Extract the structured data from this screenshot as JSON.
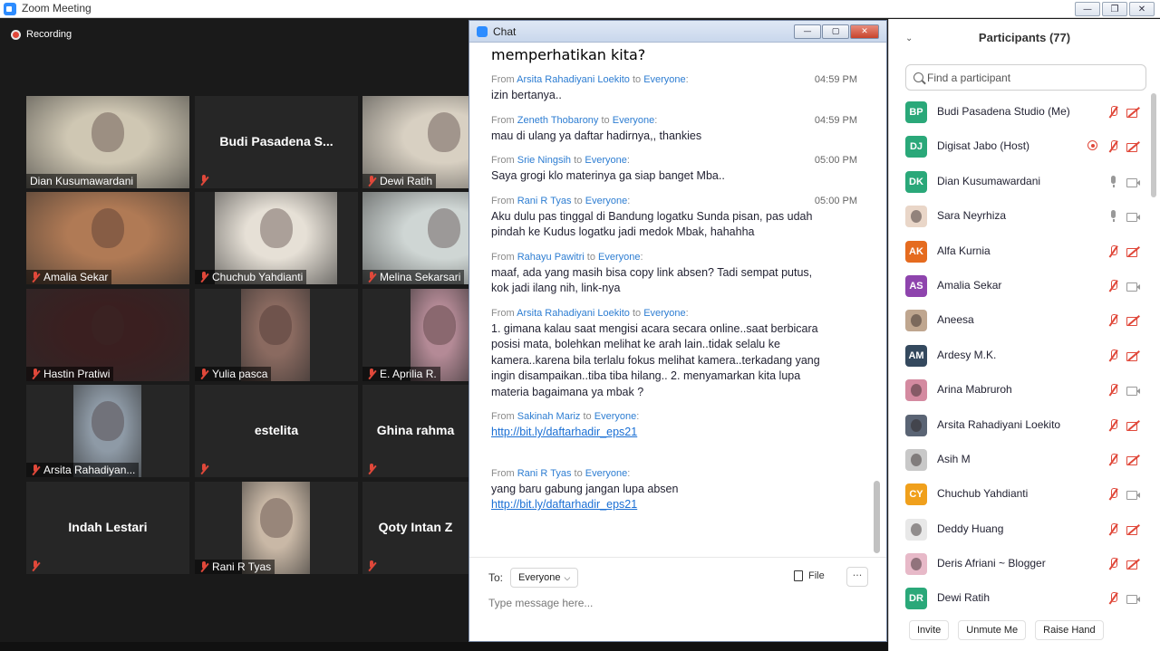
{
  "window": {
    "title": "Zoom Meeting"
  },
  "recording": {
    "label": "Recording"
  },
  "grid": [
    {
      "name": "Dian Kusumawardani",
      "muted": false,
      "video": true,
      "color": "#cfc7b3"
    },
    {
      "name": "Budi Pasadena S...",
      "muted": true,
      "video": false,
      "big": true
    },
    {
      "name": "Dewi Ratih",
      "muted": true,
      "video": true,
      "color": "#d8d0c2"
    },
    {
      "name": "Amalia Sekar",
      "muted": true,
      "video": true,
      "color": "#b07a55"
    },
    {
      "name": "Chuchub Yahdianti",
      "muted": true,
      "video": true,
      "color": "#e6e0d6"
    },
    {
      "name": "Melina Sekarsari",
      "muted": true,
      "video": true,
      "color": "#cfd6d4"
    },
    {
      "name": "Hastin Pratiwi",
      "muted": true,
      "video": true,
      "color": "#3a1f20"
    },
    {
      "name": "Yulia pasca",
      "muted": true,
      "video": true,
      "color": "#8a6a60"
    },
    {
      "name": "E. Aprilia R.",
      "muted": true,
      "video": true,
      "color": "#b48a96"
    },
    {
      "name": "Arsita Rahadiyan...",
      "muted": true,
      "video": true,
      "color": "#8e9aa6"
    },
    {
      "name": "estelita",
      "muted": true,
      "video": false,
      "big": true
    },
    {
      "name": "Ghina rahma",
      "muted": true,
      "video": false,
      "big": true
    },
    {
      "name": "Indah Lestari",
      "muted": true,
      "video": false,
      "big": true
    },
    {
      "name": "Rani R Tyas",
      "muted": true,
      "video": true,
      "color": "#c9b8a6"
    },
    {
      "name": "Qoty Intan Z",
      "muted": true,
      "video": false,
      "big": true
    }
  ],
  "chat": {
    "title": "Chat",
    "clipped_top": "memperhatikan kita?",
    "messages": [
      {
        "from": "Arsita Rahadiyani Loekito",
        "to": "Everyone",
        "time": "04:59 PM",
        "text": "izin bertanya.."
      },
      {
        "from": "Zeneth Thobarony",
        "to": "Everyone",
        "time": "04:59 PM",
        "text": "mau di ulang ya daftar hadirnya,, thankies"
      },
      {
        "from": "Srie Ningsih",
        "to": "Everyone",
        "time": "05:00 PM",
        "text": "Saya  grogi klo materinya ga siap banget Mba.."
      },
      {
        "from": "Rani R Tyas",
        "to": "Everyone",
        "time": "05:00 PM",
        "text": "Aku dulu pas tinggal di Bandung logatku Sunda pisan, pas udah\npindah ke Kudus logatku jadi medok Mbak, hahahha"
      },
      {
        "from": "Rahayu Pawitri",
        "to": "Everyone",
        "time": "",
        "text": "maaf, ada yang masih bisa copy link absen? Tadi sempat putus,\nkok jadi ilang nih, link-nya"
      },
      {
        "from": "Arsita Rahadiyani Loekito",
        "to": "Everyone",
        "time": "",
        "text": "1. gimana kalau saat mengisi acara secara online..saat berbicara\nposisi mata, bolehkan melihat ke arah lain..tidak selalu ke\nkamera..karena bila terlalu fokus melihat kamera..terkadang yang\ningin disampaikan..tiba tiba hilang.. 2. menyamarkan kita lupa\nmateria bagaimana ya mbak ?"
      },
      {
        "from": "Sakinah Mariz",
        "to": "Everyone",
        "time": "",
        "text": "",
        "link": "http://bit.ly/daftarhadir_eps21"
      },
      {
        "from": "Rani R Tyas",
        "to": "Everyone",
        "time": "",
        "text": "yang baru gabung jangan lupa absen",
        "link": "http://bit.ly/daftarhadir_eps21"
      }
    ],
    "from_word": "From",
    "to_word": "to",
    "compose": {
      "to_label": "To:",
      "recipient": "Everyone",
      "file_label": "File",
      "more_label": "···",
      "placeholder": "Type message here..."
    }
  },
  "participants": {
    "title": "Participants (77)",
    "search_placeholder": "Find a participant",
    "list": [
      {
        "initials": "BP",
        "color": "#2aa879",
        "name": "Budi Pasadena Studio (Me)",
        "mic": "muted",
        "cam": "off"
      },
      {
        "initials": "DJ",
        "color": "#2aa879",
        "name": "Digisat Jabo (Host)",
        "mic": "muted",
        "cam": "off",
        "rec": true
      },
      {
        "initials": "DK",
        "color": "#2aa879",
        "name": "Dian Kusumawardani",
        "mic": "on",
        "cam": "on"
      },
      {
        "initials": "",
        "color": "#e9d6c8",
        "name": "Sara Neyrhiza",
        "mic": "on",
        "cam": "on",
        "photo": true
      },
      {
        "initials": "AK",
        "color": "#e56b1f",
        "name": "Alfa Kurnia",
        "mic": "muted",
        "cam": "off"
      },
      {
        "initials": "AS",
        "color": "#8e44ad",
        "name": "Amalia Sekar",
        "mic": "muted",
        "cam": "on"
      },
      {
        "initials": "",
        "color": "#bfa68f",
        "name": "Aneesa",
        "mic": "muted",
        "cam": "off",
        "photo": true
      },
      {
        "initials": "AM",
        "color": "#34495e",
        "name": "Ardesy M.K.",
        "mic": "muted",
        "cam": "off"
      },
      {
        "initials": "",
        "color": "#d48aa0",
        "name": "Arina Mabruroh",
        "mic": "muted",
        "cam": "on",
        "photo": true
      },
      {
        "initials": "",
        "color": "#5a6474",
        "name": "Arsita Rahadiyani Loekito",
        "mic": "muted",
        "cam": "off",
        "photo": true
      },
      {
        "initials": "",
        "color": "#c8c8c8",
        "name": "Asih M",
        "mic": "muted",
        "cam": "off",
        "photo": true
      },
      {
        "initials": "CY",
        "color": "#f0a01c",
        "name": "Chuchub Yahdianti",
        "mic": "muted",
        "cam": "on"
      },
      {
        "initials": "",
        "color": "#e8e8e8",
        "name": "Deddy Huang",
        "mic": "muted",
        "cam": "off",
        "photo": true
      },
      {
        "initials": "",
        "color": "#e7b9c8",
        "name": "Deris Afriani ~ Blogger",
        "mic": "muted",
        "cam": "off",
        "photo": true
      },
      {
        "initials": "DR",
        "color": "#2aa879",
        "name": "Dewi Ratih",
        "mic": "muted",
        "cam": "on"
      }
    ],
    "footer": {
      "invite": "Invite",
      "unmute": "Unmute Me",
      "raise": "Raise Hand"
    }
  },
  "colors": {
    "accent": "#2d8cff",
    "muted_red": "#e0483a",
    "link": "#1a6fd4"
  }
}
